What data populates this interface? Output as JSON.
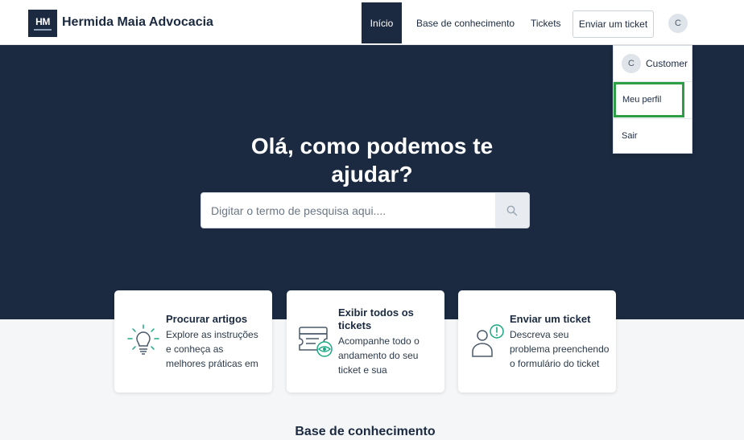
{
  "header": {
    "logo_text": "HM",
    "brand": "Hermida Maia Advocacia",
    "nav": {
      "inicio": "Início",
      "base": "Base de conhecimento",
      "tickets": "Tickets",
      "enviar": "Enviar um ticket"
    },
    "avatar_initial": "C"
  },
  "hero": {
    "title": "Olá, como podemos te ajudar?",
    "search_placeholder": "Digitar o termo de pesquisa aqui...."
  },
  "dropdown": {
    "avatar_initial": "C",
    "username": "Customer",
    "profile": "Meu perfil",
    "logout": "Sair"
  },
  "cards": [
    {
      "title": "Procurar artigos",
      "desc": "Explore as instruções e conheça as melhores práticas em nossa ba…",
      "icon": "lightbulb-icon"
    },
    {
      "title": "Exibir todos os tickets",
      "desc": "Acompanhe todo o andamento do seu ticket e sua interação…",
      "icon": "ticket-eye-icon"
    },
    {
      "title": "Enviar um ticket",
      "desc": "Descreva seu problema preenchendo o formulário do ticket …",
      "icon": "user-alert-icon"
    }
  ],
  "section": {
    "title": "Base de conhecimento"
  },
  "colors": {
    "primary": "#1b2a40",
    "accent": "#1aa882",
    "highlight": "#2c9f45"
  }
}
